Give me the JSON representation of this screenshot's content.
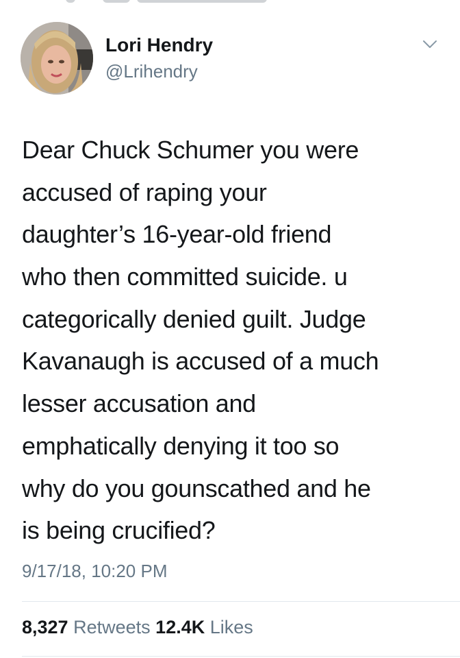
{
  "author": {
    "name": "Lori Hendry",
    "handle": "@Lrihendry",
    "avatar_icon": "profile-photo"
  },
  "tweet": {
    "lines": [
      "Dear Chuck Schumer you were",
      "accused of raping your",
      "daughter’s 16-year-old friend",
      "who then committed suicide. u",
      "categorically denied guilt. Judge",
      "Kavanaugh is accused of a much",
      "lesser accusation and",
      "emphatically denying it too so",
      "why do you gounscathed and he",
      "is being crucified?"
    ],
    "timestamp": "9/17/18, 10:20 PM"
  },
  "stats": {
    "retweets_count": "8,327",
    "retweets_label": "Retweets",
    "likes_count": "12.4K",
    "likes_label": "Likes"
  },
  "colors": {
    "text": "#14171a",
    "secondary": "#657786",
    "divider": "#e1e8ed"
  },
  "icons": {
    "menu": "chevron-down-icon"
  }
}
